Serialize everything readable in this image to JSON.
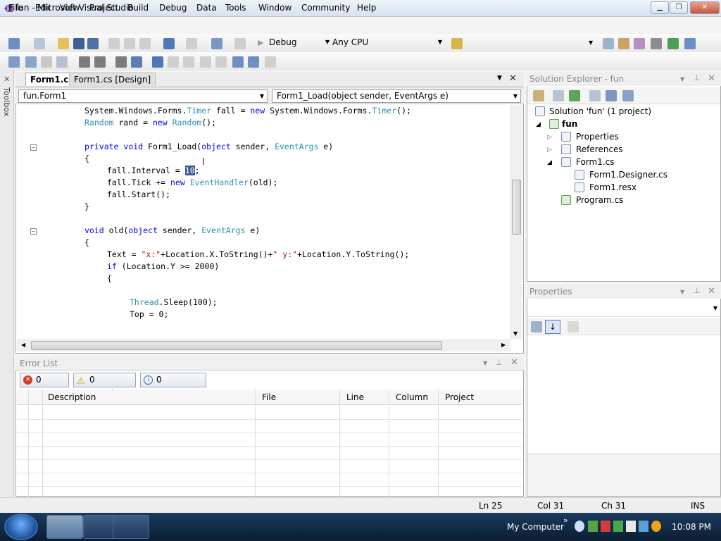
{
  "window": {
    "title": "fun - Microsoft Visual Studio"
  },
  "menu": [
    "File",
    "Edit",
    "View",
    "Project",
    "Build",
    "Debug",
    "Data",
    "Tools",
    "Window",
    "Community",
    "Help"
  ],
  "toolbar": {
    "config": "Debug",
    "platform": "Any CPU"
  },
  "toolbox_label": "Toolbox",
  "editor": {
    "tabs": [
      "Form1.cs",
      "Form1.cs [Design]"
    ],
    "class_combo": "fun.Form1",
    "member_combo": "Form1_Load(object sender, EventArgs e)"
  },
  "code": {
    "l1a": "System.Windows.Forms.",
    "l1b": "Timer",
    "l1c": " fall = ",
    "l1d": "new",
    "l1e": " System.Windows.Forms.",
    "l1f": "Timer",
    "l1g": "();",
    "l2a": "Random",
    "l2b": " rand = ",
    "l2c": "new",
    "l2d": " ",
    "l2e": "Random",
    "l2f": "();",
    "l3a": "private",
    "l3b": " ",
    "l3c": "void",
    "l3d": " Form1_Load(",
    "l3e": "object",
    "l3f": " sender, ",
    "l3g": "EventArgs",
    "l3h": " e)",
    "l4": "{",
    "l5a": "fall.Interval = ",
    "l5b": "10",
    "l5c": ";",
    "l6a": "fall.Tick += ",
    "l6b": "new",
    "l6c": " ",
    "l6d": "EventHandler",
    "l6e": "(old);",
    "l7": "fall.Start();",
    "l8": "}",
    "l9a": "void",
    "l9b": " old(",
    "l9c": "object",
    "l9d": " sender, ",
    "l9e": "EventArgs",
    "l9f": " e)",
    "l10": "{",
    "l11a": "Text = ",
    "l11b": "\"x:\"",
    "l11c": "+Location.X.ToString()+",
    "l11d": "\" y:\"",
    "l11e": "+Location.Y.ToString();",
    "l12a": "if",
    "l12b": " (Location.Y >= 2000)",
    "l13": "{",
    "l14a": "Thread",
    "l14b": ".Sleep(100);",
    "l15": "Top = 0;"
  },
  "error_list": {
    "title": "Error List",
    "errors": "0 Errors",
    "warnings": "0 Warnings",
    "messages": "0 Messages",
    "columns": [
      "Description",
      "File",
      "Line",
      "Column",
      "Project"
    ]
  },
  "solution_explorer": {
    "title": "Solution Explorer - fun",
    "solution": "Solution 'fun' (1 project)",
    "project": "fun",
    "items": [
      "Properties",
      "References",
      "Form1.cs",
      "Form1.Designer.cs",
      "Form1.resx",
      "Program.cs"
    ]
  },
  "properties": {
    "title": "Properties"
  },
  "status": {
    "ln": "Ln 25",
    "col": "Col 31",
    "ch": "Ch 31",
    "mode": "INS"
  },
  "taskbar": {
    "tray_label": "My Computer",
    "clock": "10:08 PM"
  }
}
